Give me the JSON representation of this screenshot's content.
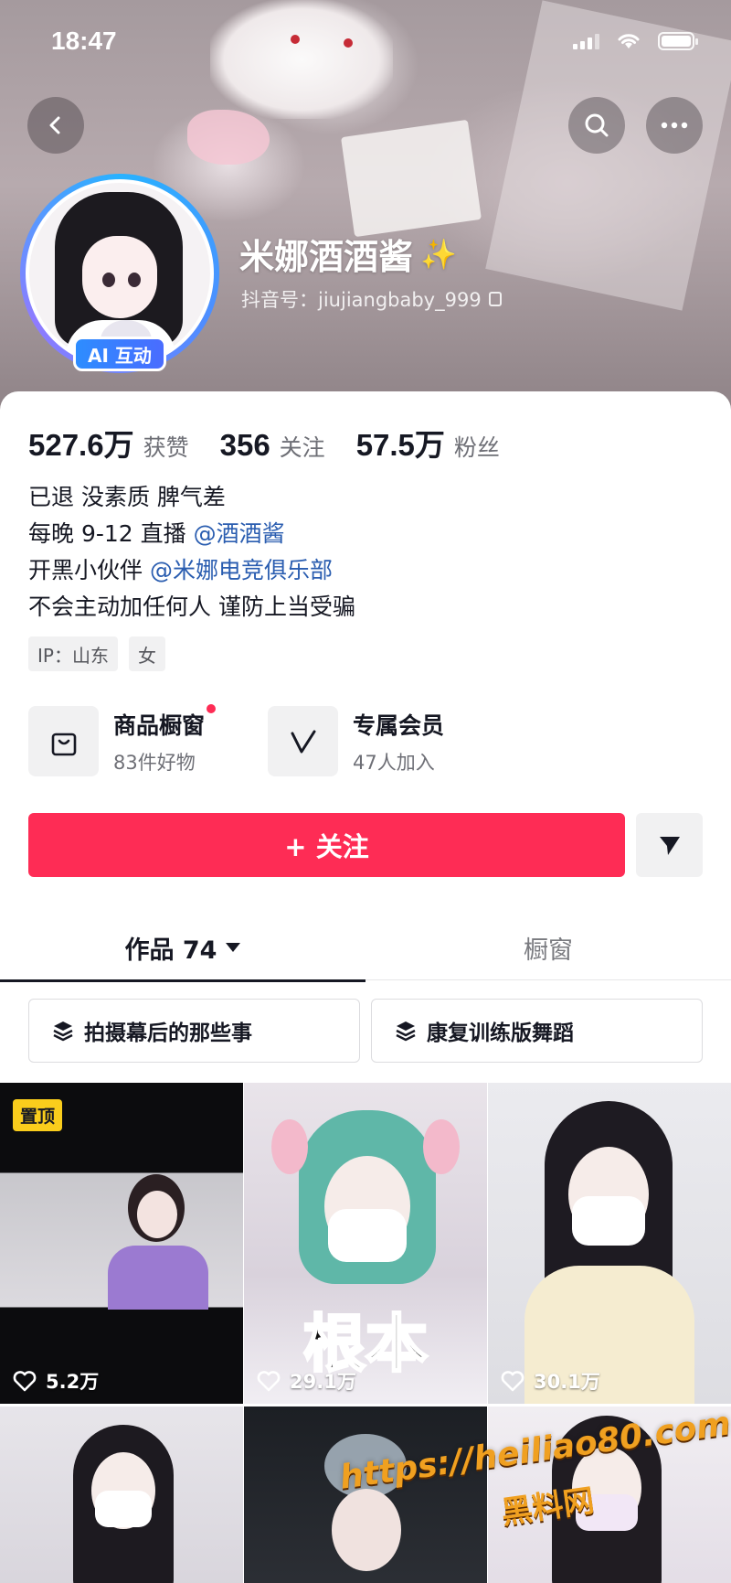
{
  "status_bar": {
    "time": "18:47"
  },
  "profile": {
    "nickname": "米娜酒酒酱",
    "sparkle": "✨",
    "handle": "抖音号：jiujiangbaby_999",
    "ai_badge": "AI 互动"
  },
  "stats": [
    {
      "value": "527.6万",
      "label": "获赞"
    },
    {
      "value": "356",
      "label": "关注"
    },
    {
      "value": "57.5万",
      "label": "粉丝"
    }
  ],
  "bio": {
    "line1": "已退 没素质 脾气差",
    "line2_prefix": "每晚 9-12 直播 ",
    "line2_mention": "@酒酒酱",
    "line3_prefix": "开黑小伙伴 ",
    "line3_mention": "@米娜电竞俱乐部",
    "line4": "不会主动加任何人 谨防上当受骗"
  },
  "tags": [
    "IP：山东",
    "女"
  ],
  "features": [
    {
      "title": "商品橱窗",
      "subtitle": "83件好物",
      "icon": "shopping-bag-icon"
    },
    {
      "title": "专属会员",
      "subtitle": "47人加入",
      "icon": "v-badge-icon"
    }
  ],
  "follow_button": "+ 关注",
  "tabs": [
    {
      "label": "作品 74",
      "active": true
    },
    {
      "label": "橱窗",
      "active": false
    }
  ],
  "collections": [
    "拍摄幕后的那些事",
    "康复训练版舞蹈"
  ],
  "videos": [
    {
      "pinned_label": "置顶",
      "likes": "5.2万",
      "overlay": ""
    },
    {
      "pinned_label": "",
      "likes": "29.1万",
      "overlay": "根本"
    },
    {
      "pinned_label": "",
      "likes": "30.1万",
      "overlay": ""
    }
  ],
  "watermark": {
    "url": "https://heiliao80.com",
    "name": "黑料网"
  },
  "colors": {
    "accent": "#fe2c55",
    "link": "#2a5db0",
    "pin": "#facd1c"
  }
}
